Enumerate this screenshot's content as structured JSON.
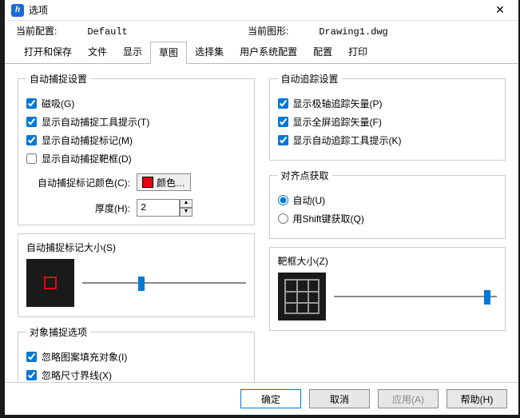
{
  "window": {
    "title": "选项",
    "close_glyph": "✕"
  },
  "info": {
    "profile_label": "当前配置:",
    "profile_value": "Default",
    "drawing_label": "当前图形:",
    "drawing_value": "Drawing1.dwg"
  },
  "tabs": [
    "打开和保存",
    "文件",
    "显示",
    "草图",
    "选择集",
    "用户系统配置",
    "配置",
    "打印"
  ],
  "active_tab_index": 3,
  "autosnap": {
    "legend": "自动捕捉设置",
    "magnet": {
      "label": "磁吸(G)",
      "checked": true
    },
    "tooltip": {
      "label": "显示自动捕捉工具提示(T)",
      "checked": true
    },
    "marker": {
      "label": "显示自动捕捉标记(M)",
      "checked": true
    },
    "aperture": {
      "label": "显示自动捕捉靶框(D)",
      "checked": false
    },
    "color_label": "自动捕捉标记颜色(C):",
    "color_btn": "颜色…",
    "thickness_label": "厚度(H):",
    "thickness_value": "2"
  },
  "autotrack": {
    "legend": "自动追踪设置",
    "polar": {
      "label": "显示极轴追踪矢量(P)",
      "checked": true
    },
    "full": {
      "label": "显示全屏追踪矢量(F)",
      "checked": true
    },
    "tooltip": {
      "label": "显示自动追踪工具提示(K)",
      "checked": true
    }
  },
  "align": {
    "legend": "对齐点获取",
    "auto": {
      "label": "自动(U)"
    },
    "shift": {
      "label": "用Shift键获取(Q)"
    },
    "selected": "auto"
  },
  "marker_size": {
    "label": "自动捕捉标记大小(S)",
    "pos_pct": 34
  },
  "aperture_size": {
    "label": "靶框大小(Z)",
    "pos_pct": 92
  },
  "osnap_opts": {
    "legend": "对象捕捉选项",
    "hatch": {
      "label": "忽略图案填充对象(I)",
      "checked": true
    },
    "dimext": {
      "label": "忽略尺寸界线(X)",
      "checked": true
    }
  },
  "buttons": {
    "ok": "确定",
    "cancel": "取消",
    "apply": "应用(A)",
    "help": "帮助(H)"
  }
}
